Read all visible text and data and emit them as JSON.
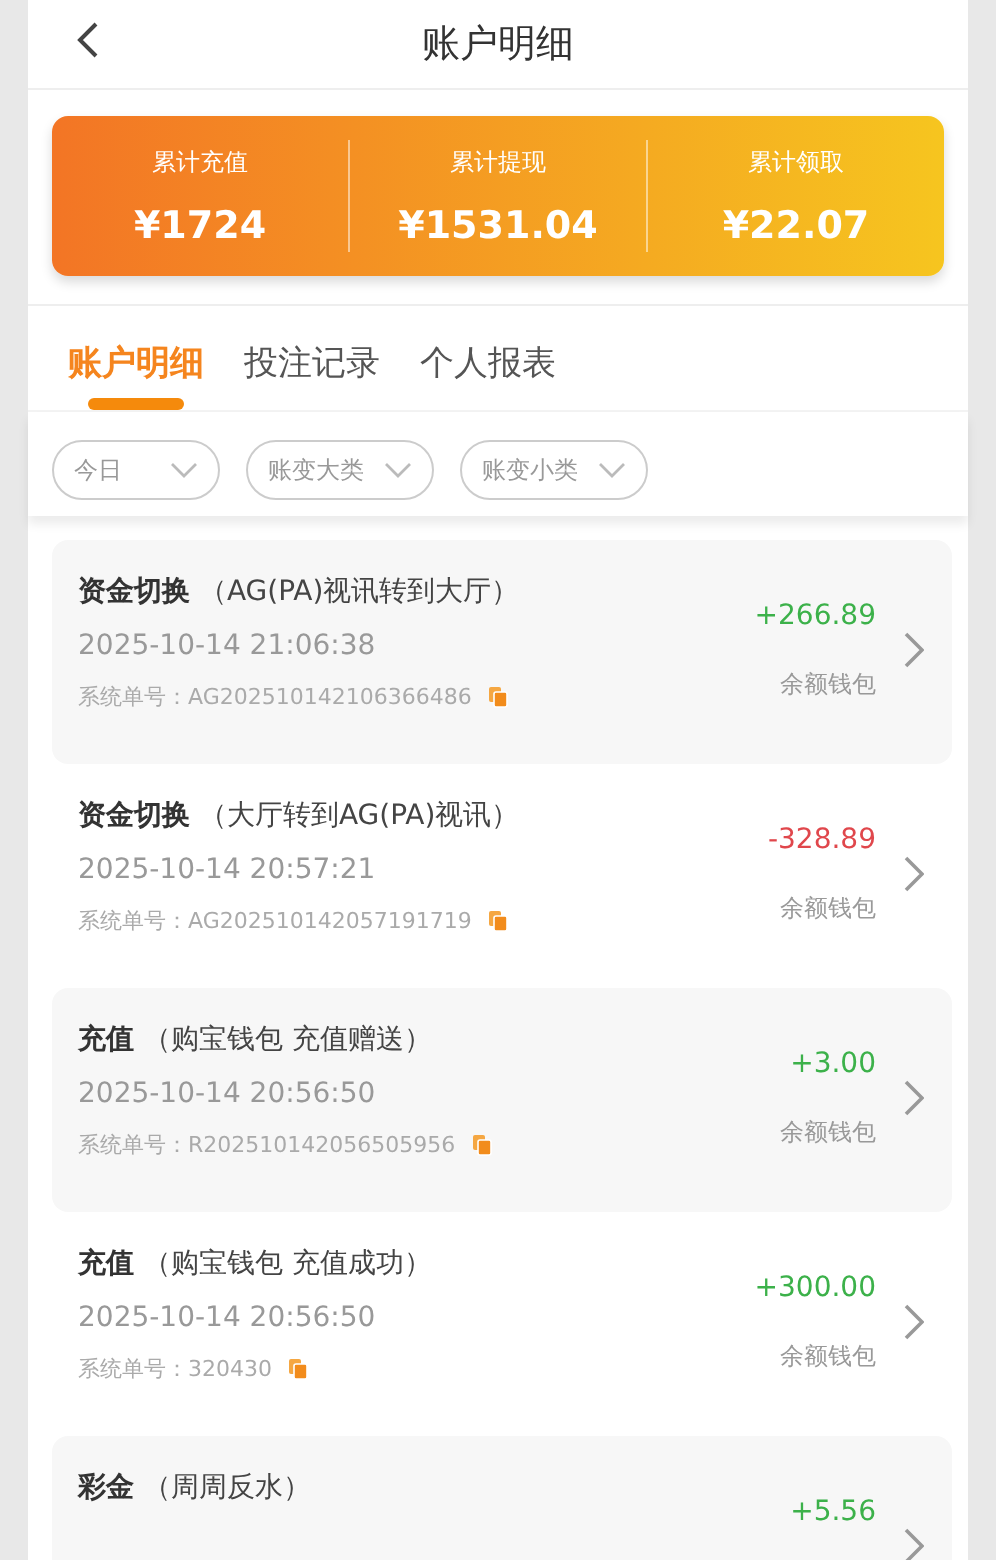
{
  "header": {
    "title": "账户明细"
  },
  "summary": [
    {
      "label": "累计充值",
      "value": "¥1724"
    },
    {
      "label": "累计提现",
      "value": "¥1531.04"
    },
    {
      "label": "累计领取",
      "value": "¥22.07"
    }
  ],
  "tabs": [
    {
      "label": "账户明细",
      "selected": true
    },
    {
      "label": "投注记录",
      "selected": false
    },
    {
      "label": "个人报表",
      "selected": false
    }
  ],
  "filters": [
    "今日",
    "账变大类",
    "账变小类"
  ],
  "records": [
    {
      "type": "资金切换",
      "detail": "（AG(PA)视讯转到大厅）",
      "time": "2025-10-14 21:06:38",
      "order_label": "系统单号：",
      "order": "AG202510142106366486",
      "amount": "+266.89",
      "color": "#3cb14a",
      "wallet": "余额钱包"
    },
    {
      "type": "资金切换",
      "detail": "（大厅转到AG(PA)视讯）",
      "time": "2025-10-14 20:57:21",
      "order_label": "系统单号：",
      "order": "AG202510142057191719",
      "amount": "-328.89",
      "color": "#e0474c",
      "wallet": "余额钱包"
    },
    {
      "type": "充值",
      "detail": "（购宝钱包 充值赠送）",
      "time": "2025-10-14 20:56:50",
      "order_label": "系统单号：",
      "order": "R202510142056505956",
      "amount": "+3.00",
      "color": "#3cb14a",
      "wallet": "余额钱包"
    },
    {
      "type": "充值",
      "detail": "（购宝钱包 充值成功）",
      "time": "2025-10-14 20:56:50",
      "order_label": "系统单号：",
      "order": "320430",
      "amount": "+300.00",
      "color": "#3cb14a",
      "wallet": "余额钱包"
    },
    {
      "type": "彩金",
      "detail": "（周周反水）",
      "amount": "+5.56",
      "color": "#3cb14a"
    }
  ]
}
